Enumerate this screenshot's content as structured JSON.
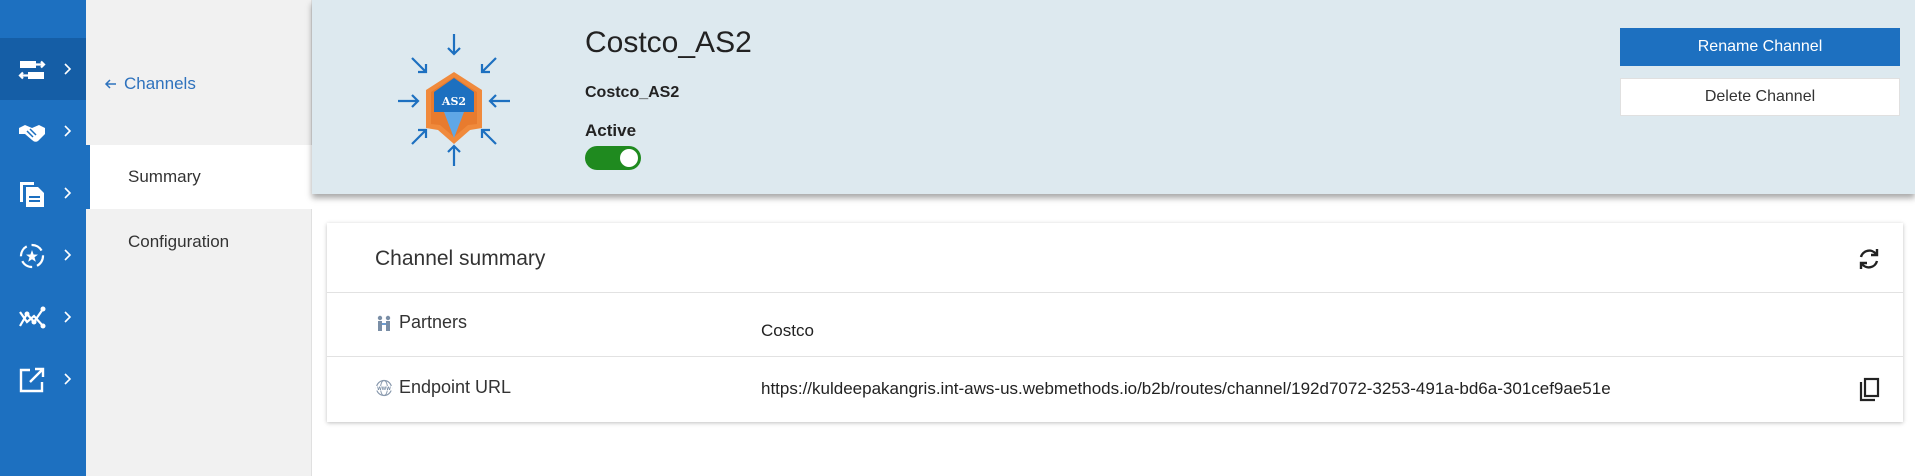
{
  "rail": {
    "items": [
      {
        "icon": "channels-icon"
      },
      {
        "icon": "handshake-icon"
      },
      {
        "icon": "documents-icon"
      },
      {
        "icon": "processing-rules-icon"
      },
      {
        "icon": "analytics-icon"
      },
      {
        "icon": "external-link-icon"
      }
    ]
  },
  "subnav": {
    "back_label": "Channels",
    "items": [
      {
        "label": "Summary"
      },
      {
        "label": "Configuration"
      }
    ]
  },
  "header": {
    "logo_text": "AS2",
    "title": "Costco_AS2",
    "subtitle": "Costco_AS2",
    "status_label": "Active",
    "toggle_on": true,
    "rename_label": "Rename Channel",
    "delete_label": "Delete Channel"
  },
  "summary": {
    "title": "Channel summary",
    "rows": [
      {
        "label": "Partners",
        "value": "Costco",
        "icon": "partners-icon"
      },
      {
        "label": "Endpoint URL",
        "value": "https://kuldeepakangris.int-aws-us.webmethods.io/b2b/routes/channel/192d7072-3253-491a-bd6a-301cef9ae51e",
        "icon": "www-icon"
      }
    ]
  },
  "colors": {
    "rail": "#1d70c0",
    "header_bg": "#dde9ef",
    "primary": "#1d70c0",
    "toggle": "#1f8a1f",
    "logo_orange": "#f08a3c",
    "logo_blue": "#2b7bc8"
  }
}
